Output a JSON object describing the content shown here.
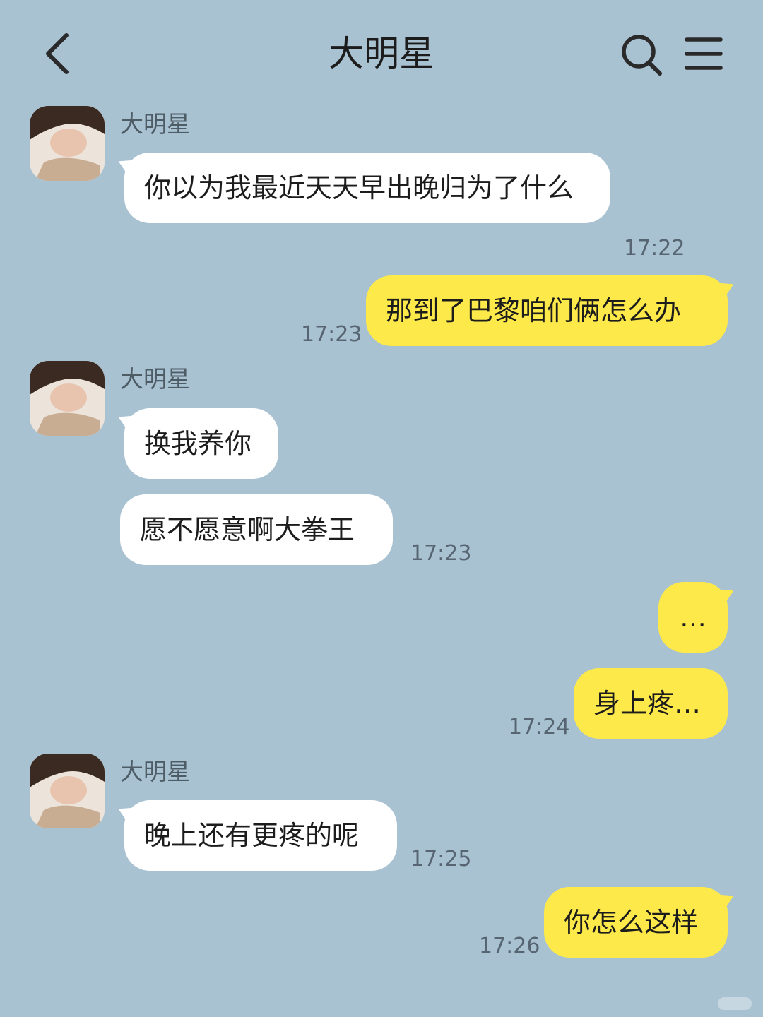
{
  "header": {
    "title": "大明星",
    "back_icon": "chevron-left-icon",
    "search_icon": "search-icon",
    "menu_icon": "menu-icon"
  },
  "colors": {
    "background": "#a9c2d2",
    "incoming_bubble": "#ffffff",
    "outgoing_bubble": "#fde94a"
  },
  "messages": [
    {
      "id": 1,
      "direction": "incoming",
      "sender": "大明星",
      "text": "你以为我最近天天早出晚归为了什么",
      "time": "17:22"
    },
    {
      "id": 2,
      "direction": "outgoing",
      "text": "那到了巴黎咱们俩怎么办",
      "time": "17:23"
    },
    {
      "id": 3,
      "direction": "incoming",
      "sender": "大明星",
      "text": "换我养你",
      "time": ""
    },
    {
      "id": 4,
      "direction": "incoming",
      "text": "愿不愿意啊大拳王",
      "time": "17:23"
    },
    {
      "id": 5,
      "direction": "outgoing",
      "text": "…",
      "time": ""
    },
    {
      "id": 6,
      "direction": "outgoing",
      "text": "身上疼…",
      "time": "17:24"
    },
    {
      "id": 7,
      "direction": "incoming",
      "sender": "大明星",
      "text": "晚上还有更疼的呢",
      "time": "17:25"
    },
    {
      "id": 8,
      "direction": "outgoing",
      "text": "你怎么这样",
      "time": "17:26"
    }
  ]
}
